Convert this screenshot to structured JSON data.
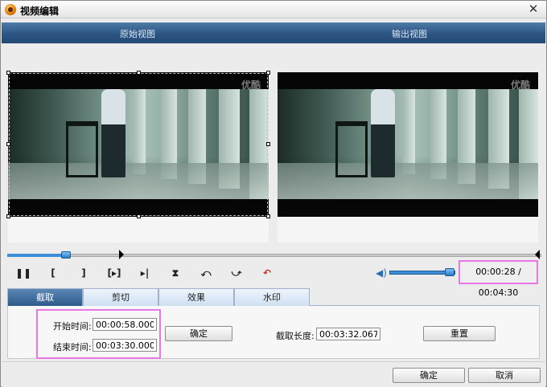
{
  "window": {
    "title": "视频编辑",
    "close_glyph": "✕"
  },
  "views": {
    "original_label": "原始视图",
    "output_label": "输出视图",
    "watermark": "优酷"
  },
  "playback": {
    "progress_fraction": 0.11,
    "time_display": "00:00:28 / 00:04:30",
    "volume_fraction": 0.92,
    "controls": [
      "pause",
      "mark-in",
      "mark-out",
      "play-selection",
      "play-to-end",
      "fit",
      "rotate-left",
      "rotate-right",
      "undo"
    ]
  },
  "tabs": [
    {
      "label": "截取",
      "active": true
    },
    {
      "label": "剪切",
      "active": false
    },
    {
      "label": "效果",
      "active": false
    },
    {
      "label": "水印",
      "active": false
    }
  ],
  "clip": {
    "start_label": "开始时间:",
    "start_value": "00:00:58.000",
    "end_label": "结束时间:",
    "end_value": "00:03:30.000",
    "confirm_label": "确定",
    "length_label": "截取长度:",
    "length_value": "00:03:32.067",
    "reset_label": "重置"
  },
  "footer": {
    "ok_label": "确定",
    "cancel_label": "取消"
  },
  "colors": {
    "accent": "#2c5583",
    "highlight": "#e878e8",
    "tab_active": "#2e5a8b"
  }
}
